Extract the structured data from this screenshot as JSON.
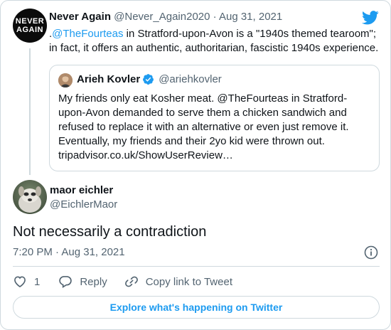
{
  "parent_tweet": {
    "avatar_text_line1": "NEVER",
    "avatar_text_line2": "AGAIN",
    "author_name": "Never Again",
    "meta": "@Never_Again2020 · Aug 31, 2021",
    "text_prefix": ".",
    "mention": "@TheFourteas",
    "text_rest": " in Stratford-upon-Avon is a \"1940s themed tearoom\"; in fact, it offers an authentic, authoritarian, fascistic 1940s experience."
  },
  "quoted_tweet": {
    "author_name": "Arieh Kovler",
    "handle": "@ariehkovler",
    "text": "My friends only eat Kosher meat. @TheFourteas in Stratford-upon-Avon demanded to serve them a chicken sandwich and refused to replace it with an alternative or even just remove it. Eventually, my friends and their 2yo kid were thrown out. tripadvisor.co.uk/ShowUserReview…"
  },
  "tweet": {
    "author_name": "maor eichler",
    "handle": "@EichlerMaor",
    "text": "Not necessarily a contradiction",
    "timestamp": "7:20 PM · Aug 31, 2021"
  },
  "actions": {
    "like_count": "1",
    "reply_label": "Reply",
    "copy_link_label": "Copy link to Tweet"
  },
  "explore_label": "Explore what's happening on Twitter",
  "colors": {
    "accent": "#1d9bf0",
    "secondary_text": "#536471",
    "border": "#cfd9de"
  }
}
